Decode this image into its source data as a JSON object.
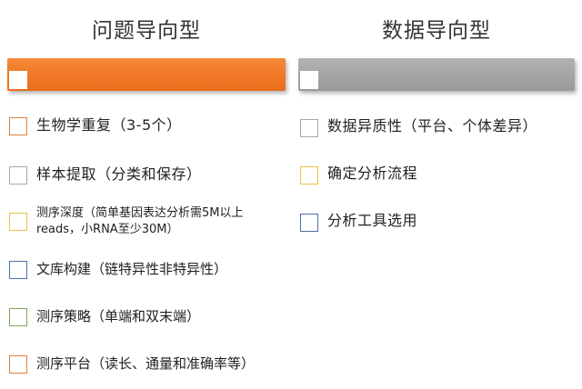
{
  "left": {
    "title": "问题导向型",
    "bar_color": "#f07826",
    "items": [
      {
        "label": "生物学重复（3-5个）",
        "box_color": "#e0803a"
      },
      {
        "label": "样本提取（分类和保存）",
        "box_color": "#a8a8a8"
      },
      {
        "label": "测序深度（简单基因表达分析需5M以上reads，小RNA至少30M）",
        "box_color": "#e8c24a"
      },
      {
        "label": "文库构建（链特异性非特异性）",
        "box_color": "#4a6fa8"
      },
      {
        "label": "测序策略（单端和双末端）",
        "box_color": "#7aa85a"
      },
      {
        "label": "测序平台（读长、通量和准确率等）",
        "box_color": "#e0803a"
      }
    ]
  },
  "right": {
    "title": "数据导向型",
    "bar_color": "#a4a4a4",
    "items": [
      {
        "label": "数据异质性（平台、个体差异）",
        "box_color": "#a8a8a8"
      },
      {
        "label": "确定分析流程",
        "box_color": "#e8c24a"
      },
      {
        "label": "分析工具选用",
        "box_color": "#4a6fa8"
      }
    ]
  }
}
